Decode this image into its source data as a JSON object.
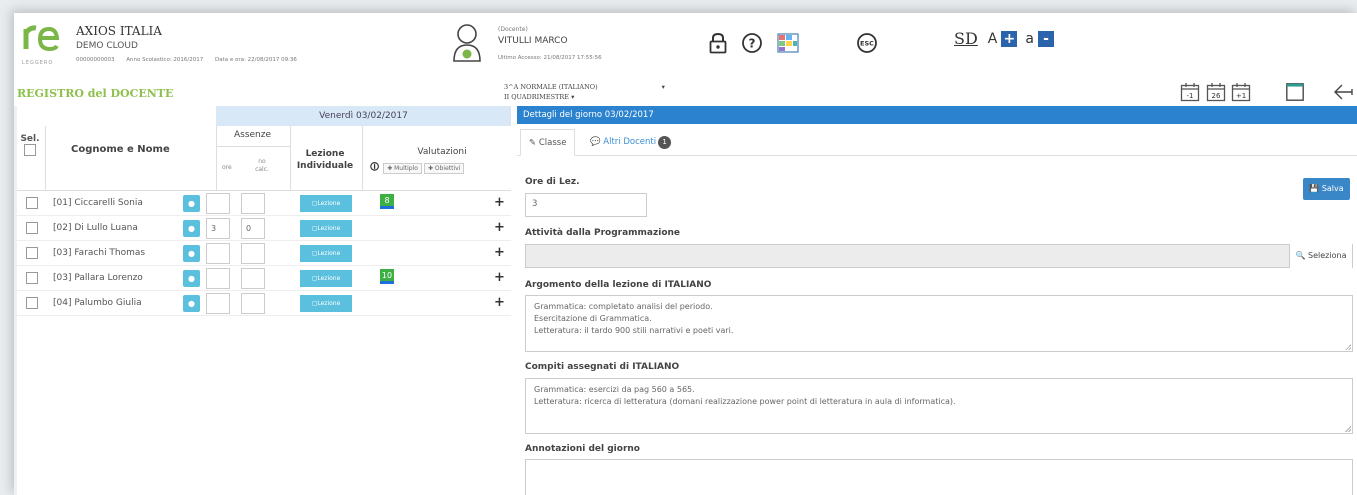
{
  "header": {
    "app_name": "AXIOS ITALIA",
    "app_sub": "DEMO CLOUD",
    "logo_sub": "LEGGERO",
    "school_code": "00000000003",
    "school_year": "Anno Scolastico: 2016/2017",
    "datetime": "Data e ora: 22/08/2017 09:36",
    "user_role": "(Docente)",
    "user_name": "VITULLI MARCO",
    "last_access": "Ultimo Accesso: 21/08/2017 17:55:56",
    "icons": [
      "lock-icon",
      "help-icon",
      "calendar-grid-icon",
      "esc-icon"
    ],
    "font_ctrl": {
      "sd": "SD",
      "bigA": "A",
      "plus": "+",
      "smallA": "a",
      "minus": "-"
    }
  },
  "subheader": {
    "title": "REGISTRO del DOCENTE",
    "class": "3^A NORMALE (ITALIANO)",
    "period": "II QUADRIMESTRE ▾",
    "caret": "▾",
    "day_prev": "-1",
    "day_today": "26",
    "day_next": "+1"
  },
  "grid": {
    "date_header": "Venerdì 03/02/2017",
    "col_sel": "Sel.",
    "col_name": "Cognome e Nome",
    "col_assenze": "Assenze",
    "col_ore": "ore",
    "col_nocalc": "no calc.",
    "col_lezione": "Lezione Individuale",
    "col_valutazioni": "Valutazioni",
    "btn_multiplo": "✚ Multiplo",
    "btn_obiettivi": "✚ Obiettivi",
    "info_icon": "🛈",
    "rows": [
      {
        "name": "[01] Ciccarelli Sonia",
        "ore": "",
        "nocalc": "",
        "lezione": "Lezione",
        "grade": "8"
      },
      {
        "name": "[02] Di Lullo Luana",
        "ore": "3",
        "nocalc": "0",
        "lezione": "Lezione",
        "grade": ""
      },
      {
        "name": "[03] Farachi Thomas",
        "ore": "",
        "nocalc": "",
        "lezione": "Lezione",
        "grade": ""
      },
      {
        "name": "[03] Pallara Lorenzo",
        "ore": "",
        "nocalc": "",
        "lezione": "Lezione",
        "grade": "10"
      },
      {
        "name": "[04] Palumbo Giulia",
        "ore": "",
        "nocalc": "",
        "lezione": "Lezione",
        "grade": ""
      }
    ]
  },
  "details": {
    "header": "Dettagli del giorno 03/02/2017",
    "tab_classe": "Classe",
    "tab_altri": "Altri Docenti",
    "tab_altri_badge": "1",
    "ore_label": "Ore di Lez.",
    "ore_value": "3",
    "save_label": "Salva",
    "attivita_label": "Attività dalla Programmazione",
    "seleziona_label": "Seleziona",
    "argomento_label": "Argomento della lezione di ITALIANO",
    "argomento_lines": [
      "Grammatica: completato analisi del periodo.",
      "Esercitazione di Grammatica.",
      "Letteratura: il tardo 900 stili narrativi e poeti vari."
    ],
    "compiti_label": "Compiti assegnati di ITALIANO",
    "compiti_lines": [
      "Grammatica: esercizi da pag 560 a 565.",
      "Letteratura: ricerca di letteratura (domani realizzazione power point di letteratura in aula di informatica)."
    ],
    "annotazioni_label": "Annotazioni del giorno"
  }
}
